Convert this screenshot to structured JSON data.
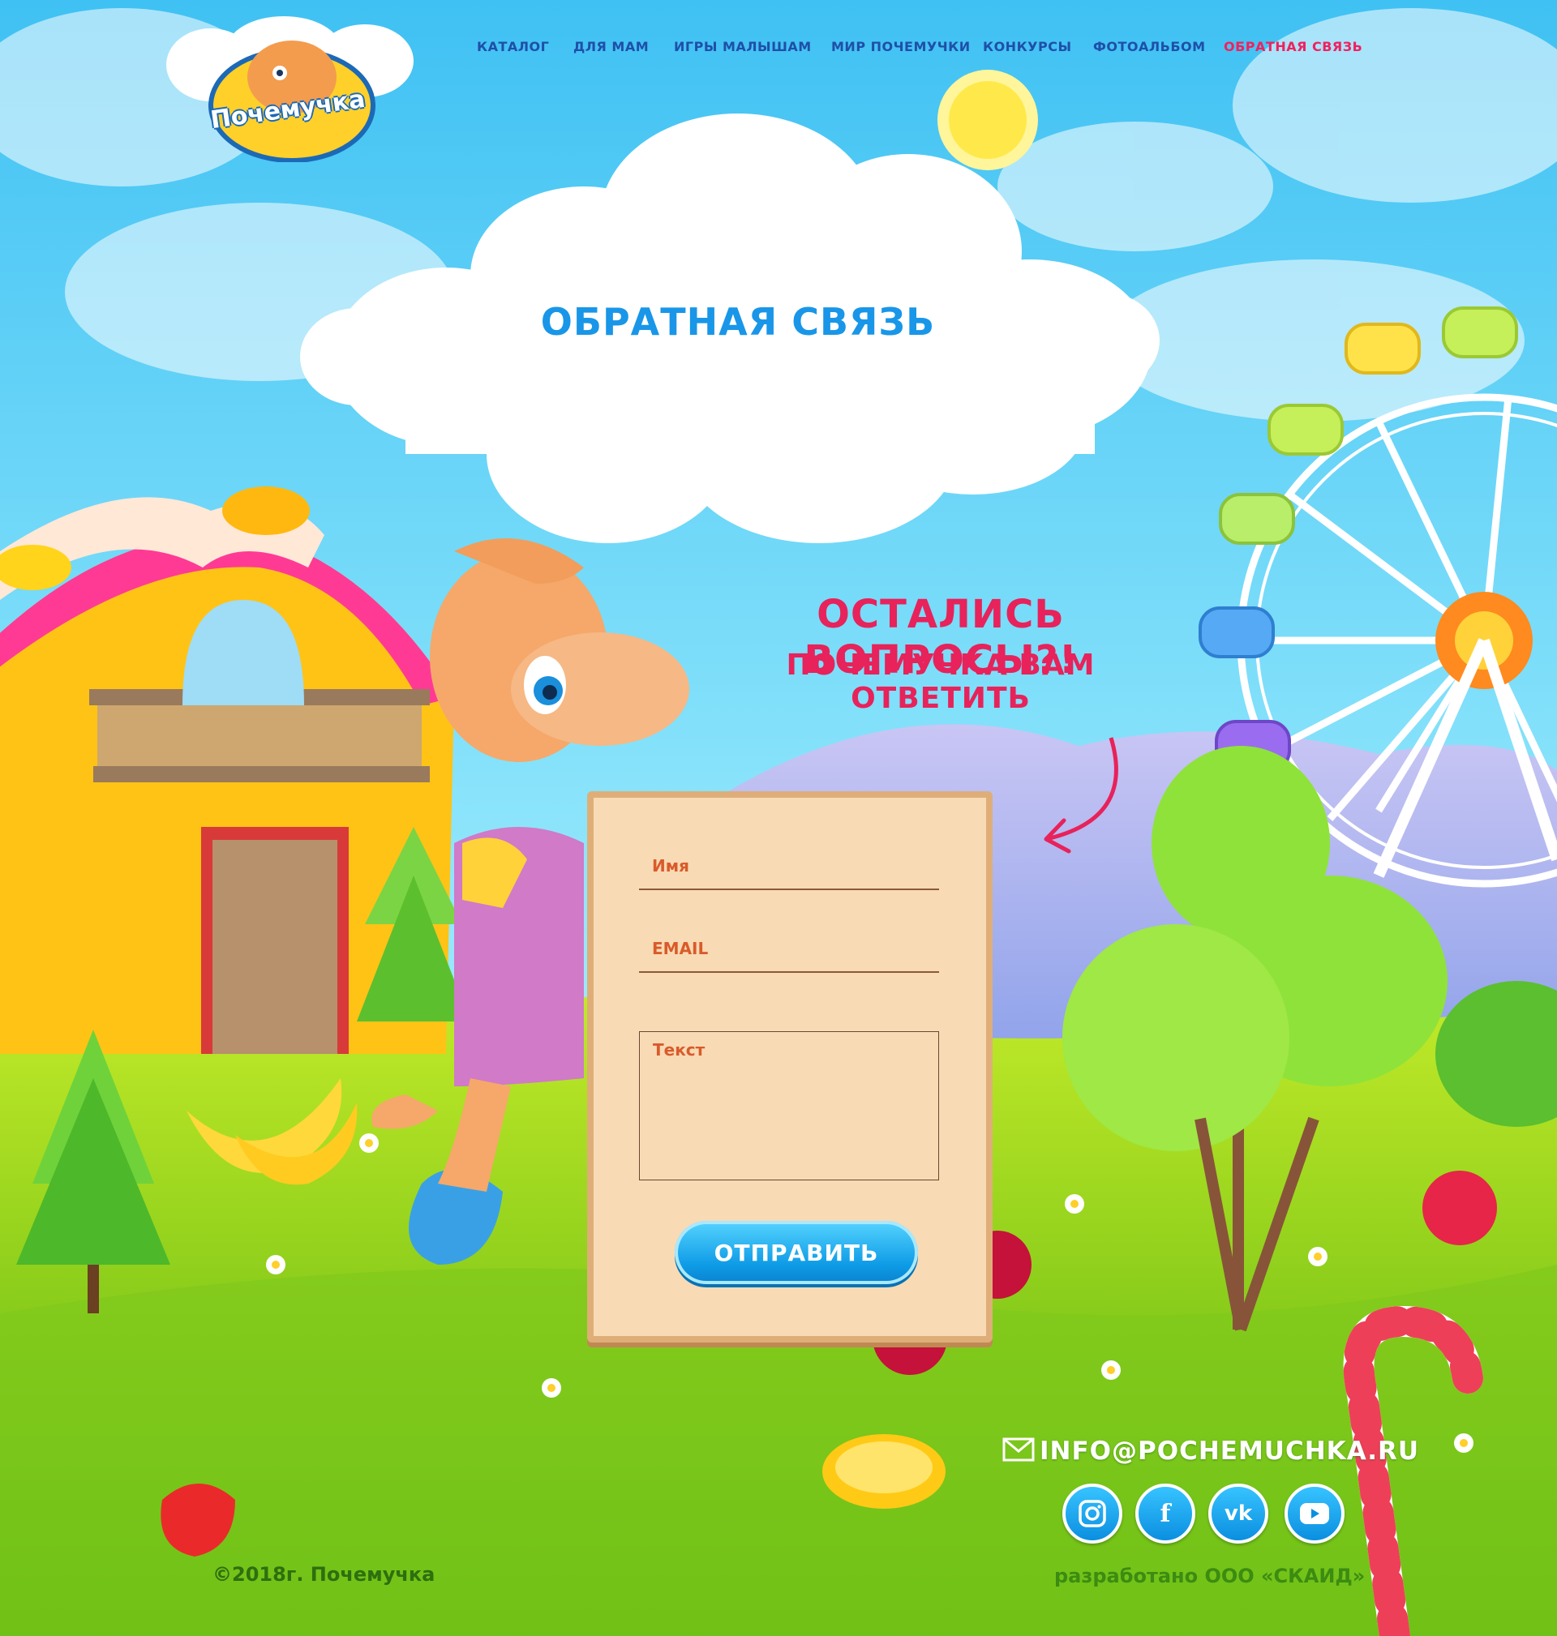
{
  "logo": {
    "text": "Почемучка"
  },
  "nav": {
    "items": [
      {
        "label": "КАТАЛОГ"
      },
      {
        "label": "ДЛЯ МАМ"
      },
      {
        "label": "ИГРЫ МАЛЫШАМ"
      },
      {
        "label": "МИР ПОЧЕМУЧКИ"
      },
      {
        "label": "КОНКУРСЫ"
      },
      {
        "label": "ФОТОАЛЬБОМ"
      },
      {
        "label": "ОБРАТНАЯ СВЯЗЬ",
        "active": true
      }
    ]
  },
  "page_title": "ОБРАТНАЯ СВЯЗЬ",
  "headline": {
    "line1": "ОСТАЛИСЬ ВОПРОСЫ?!",
    "line2": "ПОЧЕМУЧКА ВАМ ОТВЕТИТЬ"
  },
  "form": {
    "name_label": "Имя",
    "email_label": "EMAIL",
    "text_label": "Текст",
    "submit_label": "ОТПРАВИТЬ"
  },
  "footer": {
    "email": "INFO@POCHEMUCHKA.RU",
    "social": [
      {
        "icon": "instagram-icon"
      },
      {
        "icon": "facebook-icon",
        "glyph": "f"
      },
      {
        "icon": "vk-icon",
        "glyph": "vk"
      },
      {
        "icon": "youtube-icon"
      }
    ],
    "copyright": "©2018г. Почемучка",
    "developer": "разработано ООО «СКАИД»"
  },
  "colors": {
    "sky": "#5ccdf7",
    "grass": "#8fd317",
    "nav_text": "#1f4fa8",
    "nav_active": "#f0215f",
    "title_blue": "#1996e8",
    "headline_pink": "#e8225a",
    "form_bg": "#f8dab5",
    "button_blue": "#0e9be6"
  }
}
